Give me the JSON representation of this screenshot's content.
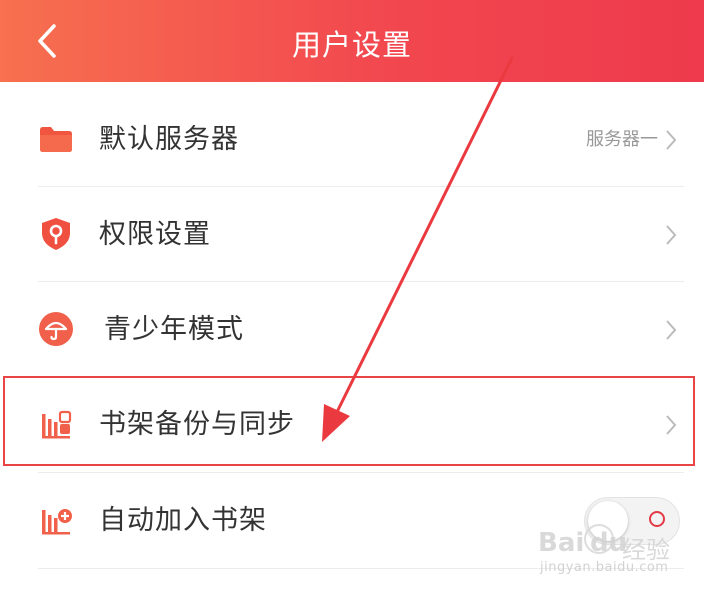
{
  "header": {
    "title": "用户设置"
  },
  "colors": {
    "accent": "#ee3a4c",
    "highlight": "#e84545"
  },
  "rows": [
    {
      "label": "默认服务器",
      "value": "服务器一",
      "icon": "folder-icon"
    },
    {
      "label": "权限设置",
      "icon": "shield-key-icon"
    },
    {
      "label": "青少年模式",
      "icon": "umbrella-icon"
    },
    {
      "label": "书架备份与同步",
      "icon": "bookshelf-sync-icon",
      "highlighted": true
    },
    {
      "label": "自动加入书架",
      "icon": "bookshelf-add-icon",
      "toggle": "off"
    }
  ],
  "watermark": {
    "brand": "Bai",
    "brand_du": "du",
    "jingyan": "经验",
    "url": "jingyan.baidu.com"
  }
}
